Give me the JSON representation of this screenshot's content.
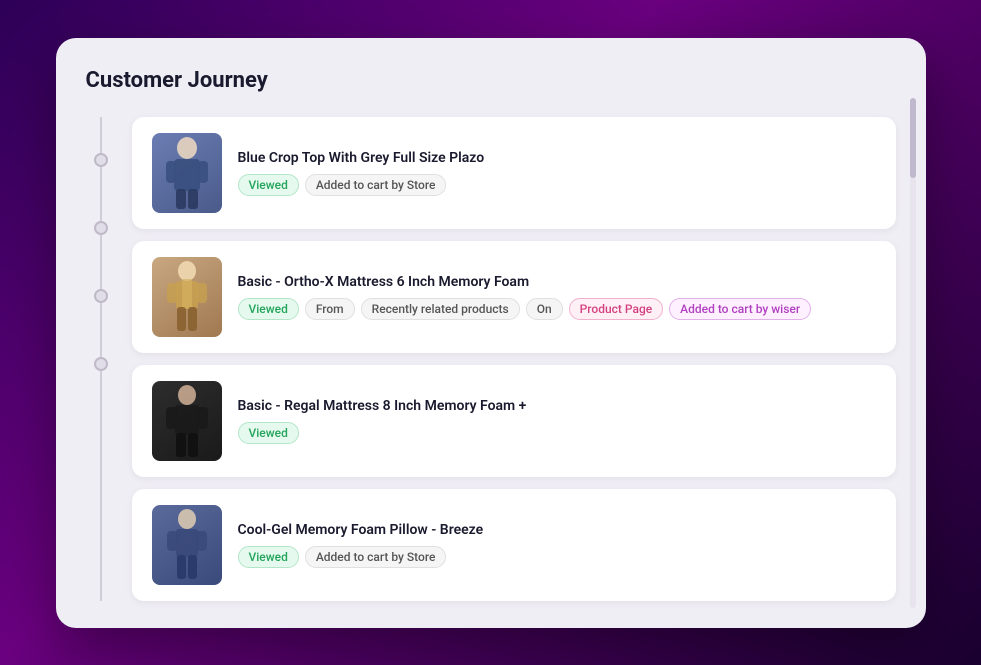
{
  "page": {
    "title": "Customer Journey"
  },
  "products": [
    {
      "id": 1,
      "name": "Blue Crop Top With Grey Full Size Plazo",
      "img_class": "img1",
      "tags": [
        {
          "text": "Viewed",
          "style": "tag-viewed"
        },
        {
          "text": "Added to cart by Store",
          "style": "tag-plain"
        }
      ]
    },
    {
      "id": 2,
      "name": "Basic - Ortho-X Mattress 6 Inch Memory Foam",
      "img_class": "img2",
      "tags": [
        {
          "text": "Viewed",
          "style": "tag-viewed"
        },
        {
          "text": "From",
          "style": "tag-plain"
        },
        {
          "text": "Recently related products",
          "style": "tag-plain"
        },
        {
          "text": "On",
          "style": "tag-plain"
        },
        {
          "text": "Product Page",
          "style": "tag-pink"
        },
        {
          "text": "Added to cart by wiser",
          "style": "tag-purple-outline"
        }
      ]
    },
    {
      "id": 3,
      "name": "Basic - Regal Mattress 8 Inch Memory Foam +",
      "img_class": "img3",
      "tags": [
        {
          "text": "Viewed",
          "style": "tag-viewed"
        }
      ]
    },
    {
      "id": 4,
      "name": "Cool-Gel Memory Foam Pillow - Breeze",
      "img_class": "img4",
      "tags": [
        {
          "text": "Viewed",
          "style": "tag-viewed"
        },
        {
          "text": "Added to cart by Store",
          "style": "tag-plain"
        }
      ]
    }
  ],
  "colors": {
    "accent": "#6b0080",
    "background": "#f0eef5"
  }
}
